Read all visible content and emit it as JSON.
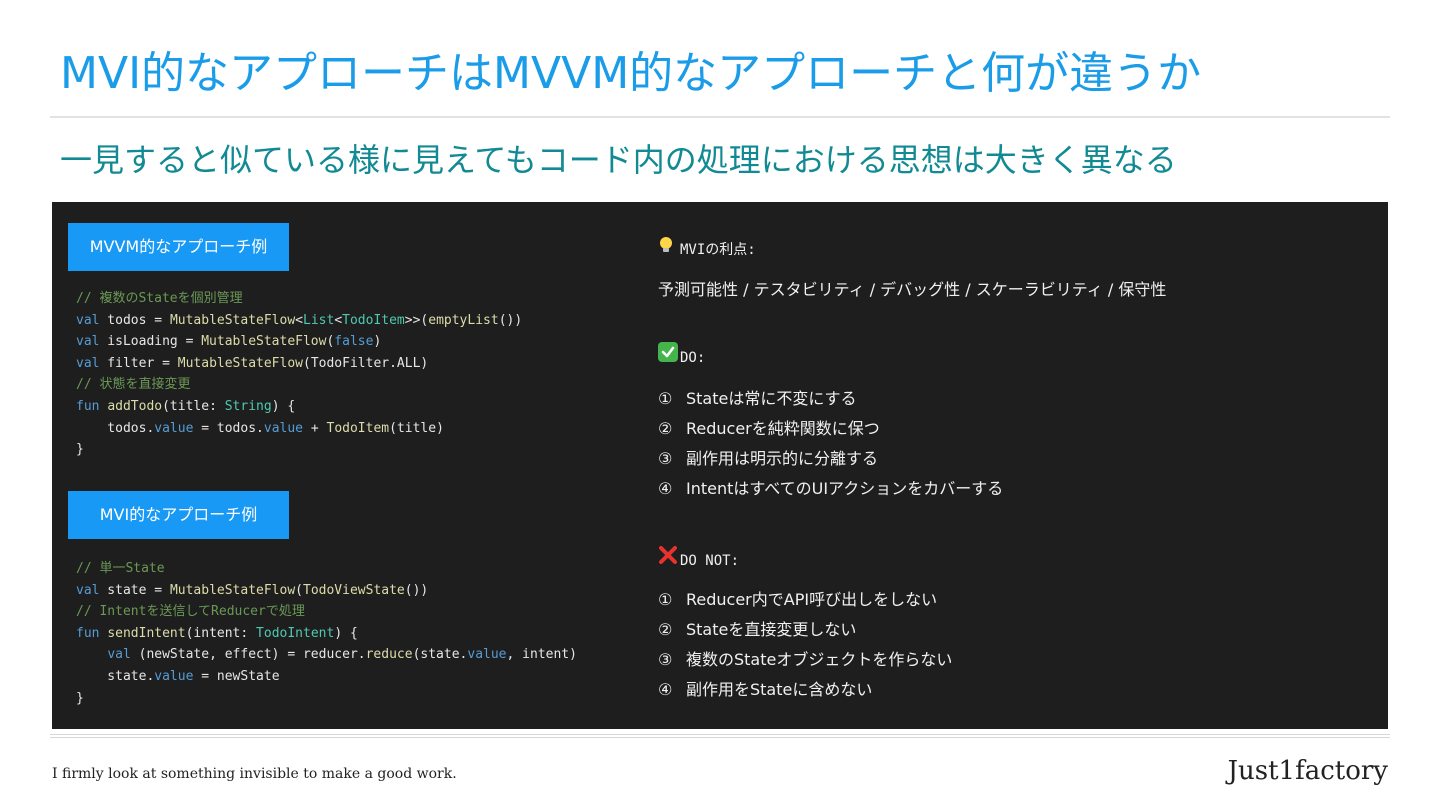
{
  "slide": {
    "title": "MVI的なアプローチはMVVM的なアプローチと何が違うか",
    "subtitle": "一見すると似ている様に見えてもコード内の処理における思想は大きく異なる"
  },
  "mvvm": {
    "label": "MVVM的なアプローチ例",
    "code": [
      [
        {
          "t": "// 複数のStateを個別管理",
          "c": "c"
        }
      ],
      [
        {
          "t": "val",
          "c": "k"
        },
        {
          "t": " todos = "
        },
        {
          "t": "MutableStateFlow",
          "c": "f"
        },
        {
          "t": "<"
        },
        {
          "t": "List",
          "c": "t"
        },
        {
          "t": "<"
        },
        {
          "t": "TodoItem",
          "c": "t"
        },
        {
          "t": ">>("
        },
        {
          "t": "emptyList",
          "c": "f"
        },
        {
          "t": "())"
        }
      ],
      [
        {
          "t": "val",
          "c": "k"
        },
        {
          "t": " isLoading = "
        },
        {
          "t": "MutableStateFlow",
          "c": "f"
        },
        {
          "t": "("
        },
        {
          "t": "false",
          "c": "k"
        },
        {
          "t": ")"
        }
      ],
      [
        {
          "t": "val",
          "c": "k"
        },
        {
          "t": " filter = "
        },
        {
          "t": "MutableStateFlow",
          "c": "f"
        },
        {
          "t": "(TodoFilter.ALL)"
        }
      ],
      [
        {
          "t": "// 状態を直接変更",
          "c": "c"
        }
      ],
      [
        {
          "t": "fun",
          "c": "k"
        },
        {
          "t": " "
        },
        {
          "t": "addTodo",
          "c": "f"
        },
        {
          "t": "(title: "
        },
        {
          "t": "String",
          "c": "t"
        },
        {
          "t": ") {"
        }
      ],
      [
        {
          "t": "    todos."
        },
        {
          "t": "value",
          "c": "k"
        },
        {
          "t": " = todos."
        },
        {
          "t": "value",
          "c": "k"
        },
        {
          "t": " + "
        },
        {
          "t": "TodoItem",
          "c": "f"
        },
        {
          "t": "(title)"
        }
      ],
      [
        {
          "t": "}"
        }
      ]
    ]
  },
  "mvi": {
    "label": "MVI的なアプローチ例",
    "code": [
      [
        {
          "t": "// 単一State",
          "c": "c"
        }
      ],
      [
        {
          "t": "val",
          "c": "k"
        },
        {
          "t": " state = "
        },
        {
          "t": "MutableStateFlow",
          "c": "f"
        },
        {
          "t": "("
        },
        {
          "t": "TodoViewState",
          "c": "f"
        },
        {
          "t": "())"
        }
      ],
      [
        {
          "t": "// Intentを送信してReducerで処理",
          "c": "c"
        }
      ],
      [
        {
          "t": "fun",
          "c": "k"
        },
        {
          "t": " "
        },
        {
          "t": "sendIntent",
          "c": "f"
        },
        {
          "t": "(intent: "
        },
        {
          "t": "TodoIntent",
          "c": "t"
        },
        {
          "t": ") {"
        }
      ],
      [
        {
          "t": "    "
        },
        {
          "t": "val",
          "c": "k"
        },
        {
          "t": " (newState, effect) = reducer."
        },
        {
          "t": "reduce",
          "c": "f"
        },
        {
          "t": "(state."
        },
        {
          "t": "value",
          "c": "k"
        },
        {
          "t": ", intent)"
        }
      ],
      [
        {
          "t": "    state."
        },
        {
          "t": "value",
          "c": "k"
        },
        {
          "t": " = newState"
        }
      ],
      [
        {
          "t": "}"
        }
      ]
    ]
  },
  "benefits": {
    "icon": "lightbulb-icon",
    "heading": "MVIの利点:",
    "text": "予測可能性 / テスタビリティ / デバッグ性 / スケーラビリティ / 保守性"
  },
  "do": {
    "icon": "check-icon",
    "heading": "DO:",
    "items": [
      {
        "num": "①",
        "text": "Stateは常に不変にする"
      },
      {
        "num": "②",
        "text": "Reducerを純粋関数に保つ"
      },
      {
        "num": "③",
        "text": "副作用は明示的に分離する"
      },
      {
        "num": "④",
        "text": "IntentはすべてのUIアクションをカバーする"
      }
    ]
  },
  "do_not": {
    "icon": "cross-icon",
    "heading": "DO NOT:",
    "items": [
      {
        "num": "①",
        "text": "Reducer内でAPI呼び出しをしない"
      },
      {
        "num": "②",
        "text": "Stateを直接変更しない"
      },
      {
        "num": "③",
        "text": "複数のStateオブジェクトを作らない"
      },
      {
        "num": "④",
        "text": "副作用をStateに含めない"
      }
    ]
  },
  "footer": {
    "tagline": "I firmly look at something invisible to make a good work.",
    "brand": "Just1factory"
  }
}
